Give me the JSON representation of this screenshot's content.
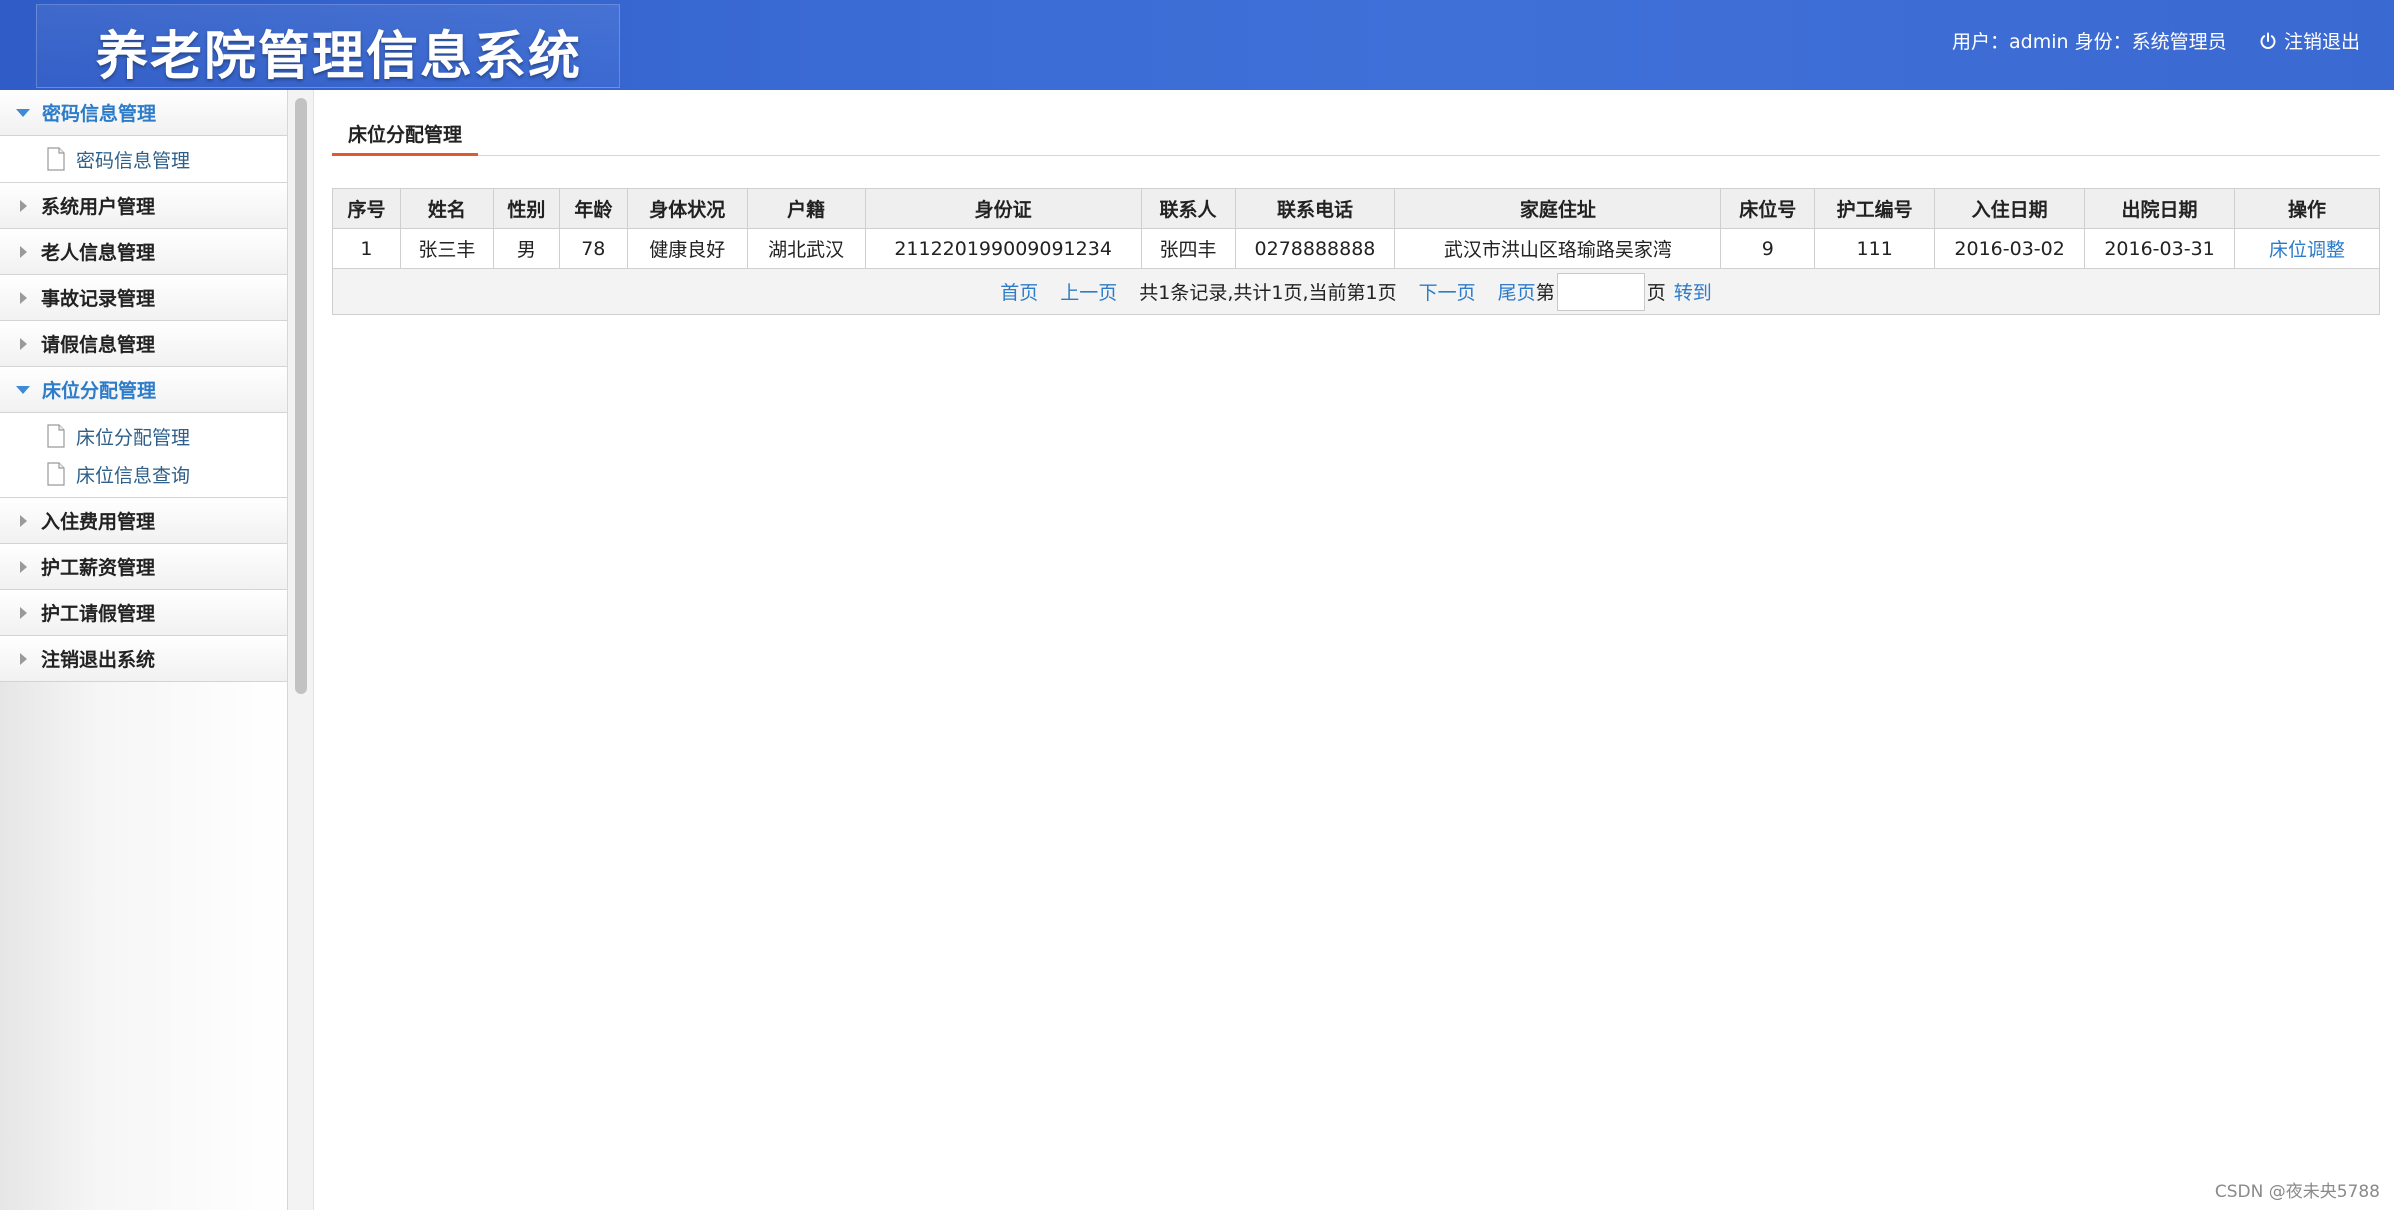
{
  "header": {
    "title": "养老院管理信息系统",
    "user_info": "用户：admin 身份：系统管理员",
    "logout_label": "注销退出"
  },
  "sidebar": {
    "groups": [
      {
        "label": "密码信息管理",
        "expanded": true,
        "items": [
          "密码信息管理"
        ]
      },
      {
        "label": "系统用户管理",
        "expanded": false
      },
      {
        "label": "老人信息管理",
        "expanded": false
      },
      {
        "label": "事故记录管理",
        "expanded": false
      },
      {
        "label": "请假信息管理",
        "expanded": false
      },
      {
        "label": "床位分配管理",
        "expanded": true,
        "items": [
          "床位分配管理",
          "床位信息查询"
        ]
      },
      {
        "label": "入住费用管理",
        "expanded": false
      },
      {
        "label": "护工薪资管理",
        "expanded": false
      },
      {
        "label": "护工请假管理",
        "expanded": false
      },
      {
        "label": "注销退出系统",
        "expanded": false
      }
    ]
  },
  "main": {
    "tab_label": "床位分配管理",
    "table": {
      "columns": [
        "序号",
        "姓名",
        "性别",
        "年龄",
        "身体状况",
        "户籍",
        "身份证",
        "联系人",
        "联系电话",
        "家庭住址",
        "床位号",
        "护工编号",
        "入住日期",
        "出院日期",
        "操作"
      ],
      "rows": [
        [
          "1",
          "张三丰",
          "男",
          "78",
          "健康良好",
          "湖北武汉",
          "211220199009091234",
          "张四丰",
          "0278888888",
          "武汉市洪山区珞瑜路吴家湾",
          "9",
          "111",
          "2016-03-02",
          "2016-03-31",
          "床位调整"
        ]
      ]
    },
    "pager": {
      "first": "首页",
      "prev": "上一页",
      "summary": "共1条记录,共计1页,当前第1页",
      "next": "下一页",
      "last": "尾页",
      "page_prefix": "第",
      "page_input_value": "",
      "page_suffix": "页",
      "go": "转到"
    }
  },
  "watermark": "CSDN @夜未央5788",
  "colors": {
    "header_bg": "#3a6ad4",
    "link": "#2d7cc9",
    "tab_underline": "#e05a2b",
    "expanded_arrow": "#3d8ad6"
  }
}
